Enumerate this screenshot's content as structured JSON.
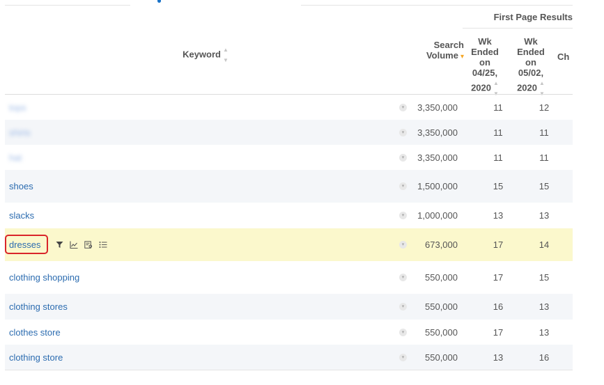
{
  "table": {
    "group_header": "First Page Results",
    "headers": {
      "keyword": "Keyword",
      "search_volume_line1": "Search",
      "search_volume_line2": "Volume",
      "wk1_lines": [
        "Wk",
        "Ended",
        "on",
        "04/25,",
        "2020"
      ],
      "wk2_lines": [
        "Wk",
        "Ended",
        "on",
        "05/02,",
        "2020"
      ],
      "change_partial": "Ch"
    },
    "sort_icon": "sort-arrows-icon",
    "sort_active_icon": "sort-desc-caret-icon",
    "rows": [
      {
        "keyword": "tops",
        "volume": "3,350,000",
        "wk1": "11",
        "wk2": "12"
      },
      {
        "keyword": "shirts",
        "volume": "3,350,000",
        "wk1": "11",
        "wk2": "11"
      },
      {
        "keyword": "hat",
        "volume": "3,350,000",
        "wk1": "11",
        "wk2": "11"
      },
      {
        "keyword": "shoes",
        "volume": "1,500,000",
        "wk1": "15",
        "wk2": "15"
      },
      {
        "keyword": "slacks",
        "volume": "1,000,000",
        "wk1": "13",
        "wk2": "13"
      },
      {
        "keyword": "dresses",
        "volume": "673,000",
        "wk1": "17",
        "wk2": "14"
      },
      {
        "keyword": "clothing shopping",
        "volume": "550,000",
        "wk1": "17",
        "wk2": "15"
      },
      {
        "keyword": "clothing stores",
        "volume": "550,000",
        "wk1": "16",
        "wk2": "13"
      },
      {
        "keyword": "clothes store",
        "volume": "550,000",
        "wk1": "17",
        "wk2": "13"
      },
      {
        "keyword": "clothing store",
        "volume": "550,000",
        "wk1": "13",
        "wk2": "16"
      }
    ],
    "row_tools": [
      "filter-icon",
      "line-chart-icon",
      "serp-snapshot-icon",
      "list-icon"
    ],
    "colors": {
      "link": "#2c6cb0",
      "highlight_row": "#fbf8cc",
      "alt_row": "#f4f6f9",
      "selection_border": "#d9252a",
      "sort_active": "#f5a623"
    }
  }
}
